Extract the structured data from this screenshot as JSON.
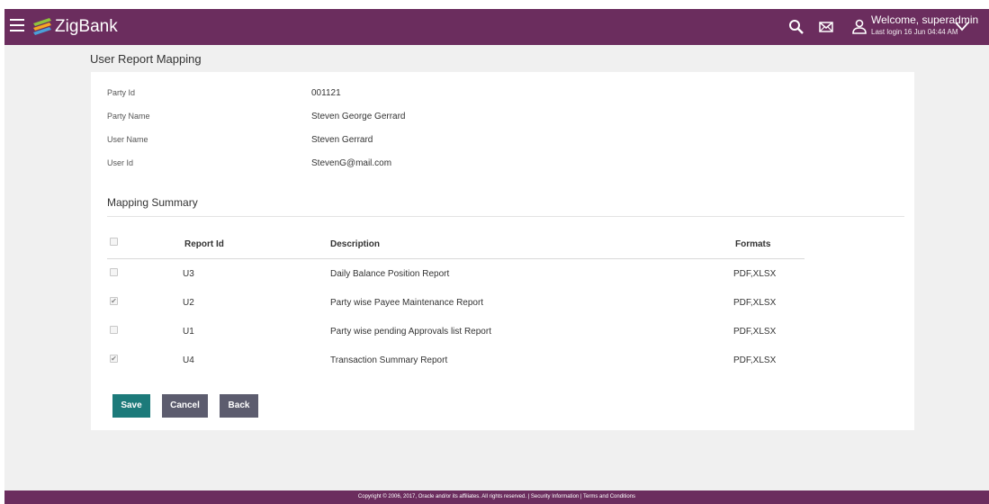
{
  "header": {
    "app_name": "ZigBank",
    "welcome": "Welcome, superadmin",
    "last_login": "Last login 16 Jun 04:44 AM",
    "icons": [
      "menu-icon",
      "search-icon",
      "mail-icon",
      "user-icon",
      "chevron-down-icon"
    ]
  },
  "page": {
    "title": "User Report Mapping"
  },
  "details": [
    {
      "label": "Party Id",
      "value": "001121"
    },
    {
      "label": "Party Name",
      "value": "Steven George Gerrard"
    },
    {
      "label": "User Name",
      "value": "Steven Gerrard"
    },
    {
      "label": "User Id",
      "value": "StevenG@mail.com"
    }
  ],
  "mapping": {
    "title": "Mapping Summary",
    "columns": [
      "Report Id",
      "Description",
      "Formats"
    ],
    "select_all_checked": false,
    "rows": [
      {
        "checked": false,
        "report_id": "U3",
        "description": "Daily Balance Position Report",
        "formats": "PDF,XLSX"
      },
      {
        "checked": true,
        "report_id": "U2",
        "description": "Party wise Payee Maintenance Report",
        "formats": "PDF,XLSX"
      },
      {
        "checked": false,
        "report_id": "U1",
        "description": "Party wise pending Approvals list Report",
        "formats": "PDF,XLSX"
      },
      {
        "checked": true,
        "report_id": "U4",
        "description": "Transaction Summary Report",
        "formats": "PDF,XLSX"
      }
    ]
  },
  "buttons": {
    "save": "Save",
    "cancel": "Cancel",
    "back": "Back"
  },
  "footer": {
    "text": "Copyright © 2006, 2017, Oracle and/or its affiliates. All rights reserved. | Security Information | Terms and Conditions"
  },
  "colors": {
    "header_bg": "#6b2d5e",
    "save_btn": "#1c7a7a",
    "secondary_btn": "#5c5c6e",
    "page_bg": "#f0f0f0"
  }
}
